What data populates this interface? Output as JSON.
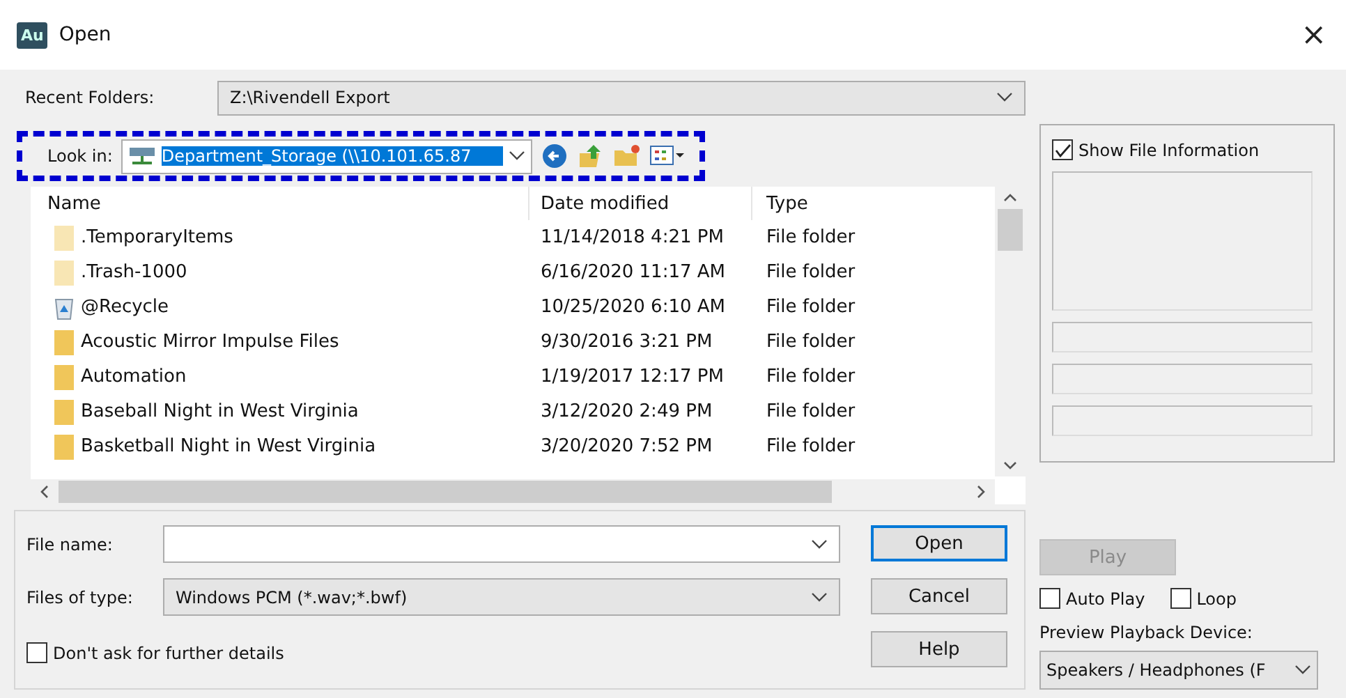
{
  "window": {
    "title": "Open",
    "app_icon": "Au",
    "close": "×"
  },
  "recent_folders": {
    "label": "Recent Folders:",
    "value": "Z:\\Rivendell Export"
  },
  "look_in": {
    "label": "Look in:",
    "value": "Department_Storage (\\\\10.101.65.87",
    "focused": true
  },
  "file_list": {
    "columns": [
      "Name",
      "Date modified",
      "Type"
    ],
    "rows": [
      {
        "kind": "hidden-folder",
        "name": ".TemporaryItems",
        "date": "11/14/2018 4:21 PM",
        "type": "File folder"
      },
      {
        "kind": "hidden-folder",
        "name": ".Trash-1000",
        "date": "6/16/2020 11:17 AM",
        "type": "File folder"
      },
      {
        "kind": "recycle",
        "name": "@Recycle",
        "date": "10/25/2020 6:10 AM",
        "type": "File folder"
      },
      {
        "kind": "folder",
        "name": "Acoustic Mirror Impulse Files",
        "date": "9/30/2016 3:21 PM",
        "type": "File folder"
      },
      {
        "kind": "folder",
        "name": "Automation",
        "date": "1/19/2017 12:17 PM",
        "type": "File folder"
      },
      {
        "kind": "folder",
        "name": "Baseball Night in West Virginia",
        "date": "3/12/2020 2:49 PM",
        "type": "File folder"
      },
      {
        "kind": "folder",
        "name": "Basketball Night in West Virginia",
        "date": "3/20/2020 7:52 PM",
        "type": "File folder"
      }
    ]
  },
  "file_name": {
    "label": "File name:"
  },
  "files_of_type": {
    "label": "Files of type:",
    "value": "Windows PCM (*.wav;*.bwf)"
  },
  "dont_ask": {
    "label": "Don't ask for further details",
    "checked": false
  },
  "buttons": [
    {
      "label": "Open",
      "default": true
    },
    {
      "label": "Cancel",
      "default": false
    },
    {
      "label": "Help",
      "default": false
    }
  ],
  "show_file_info": {
    "label": "Show File Information",
    "checked": true
  },
  "play": {
    "label": "Play",
    "disabled": true
  },
  "auto_play": {
    "label": "Auto Play",
    "checked": false
  },
  "loop": {
    "label": "Loop",
    "checked": false
  },
  "preview_device": {
    "label": "Preview Playback Device:",
    "value": "Speakers / Headphones (F"
  }
}
